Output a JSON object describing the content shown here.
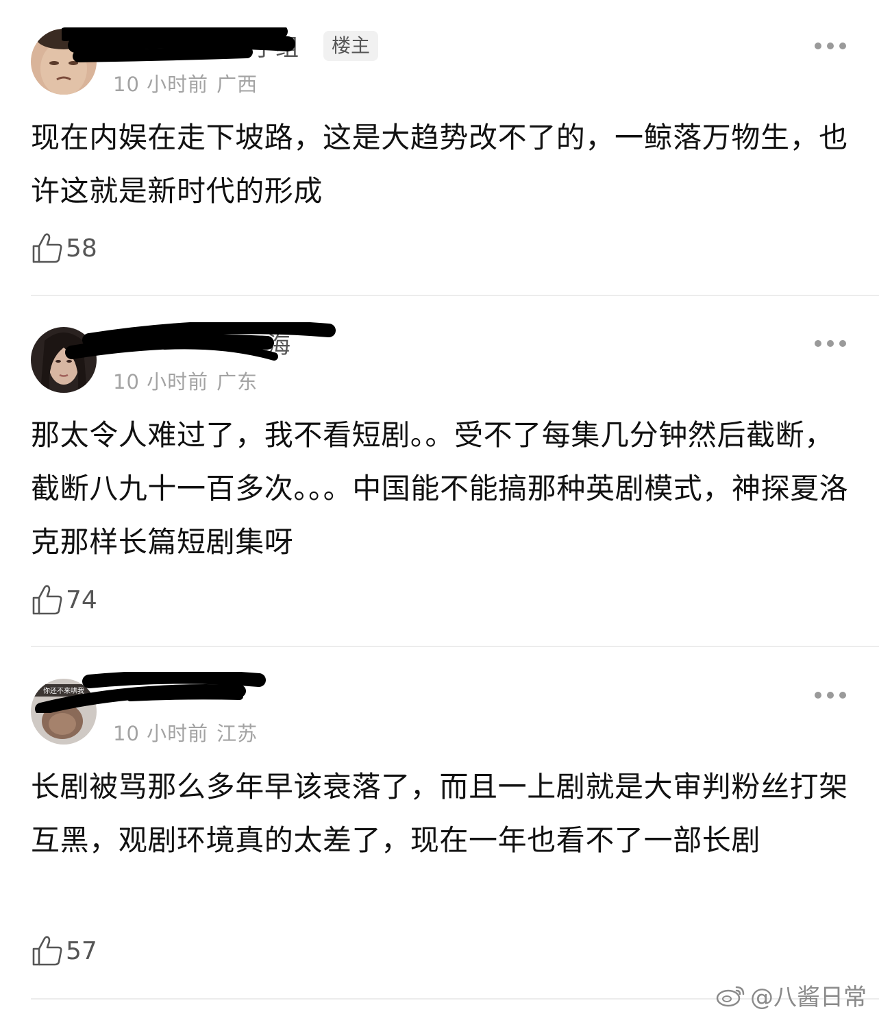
{
  "comments": [
    {
      "username": "子组",
      "op_badge": "楼主",
      "time": "10 小时前",
      "location": "广西",
      "text": "现在内娱在走下坡路，这是大趋势改不了的，一鲸落万物生，也许这就是新时代的形成",
      "likes": "58",
      "avatar_icon": "avatar-man-face"
    },
    {
      "username": "海",
      "time": "10 小时前",
      "location": "广东",
      "text": "那太令人难过了，我不看短剧。。受不了每集几分钟然后截断，截断八九十一百多次。。。中国能不能搞那种英剧模式，神探夏洛克那样长篇短剧集呀",
      "likes": "74",
      "avatar_icon": "avatar-woman-face"
    },
    {
      "username": "",
      "time": "10 小时前",
      "location": "江苏",
      "text": "长剧被骂那么多年早该衰落了，而且一上剧就是大审判粉丝打架互黑，观剧环境真的太差了，现在一年也看不了一部长剧",
      "likes": "57",
      "avatar_icon": "avatar-meme",
      "avatar_caption": "你还不来哄我"
    }
  ],
  "icons": {
    "more": "more-dots-icon",
    "like": "thumbs-up-icon",
    "watermark_logo": "weibo-logo-icon"
  },
  "watermark": "@八酱日常"
}
